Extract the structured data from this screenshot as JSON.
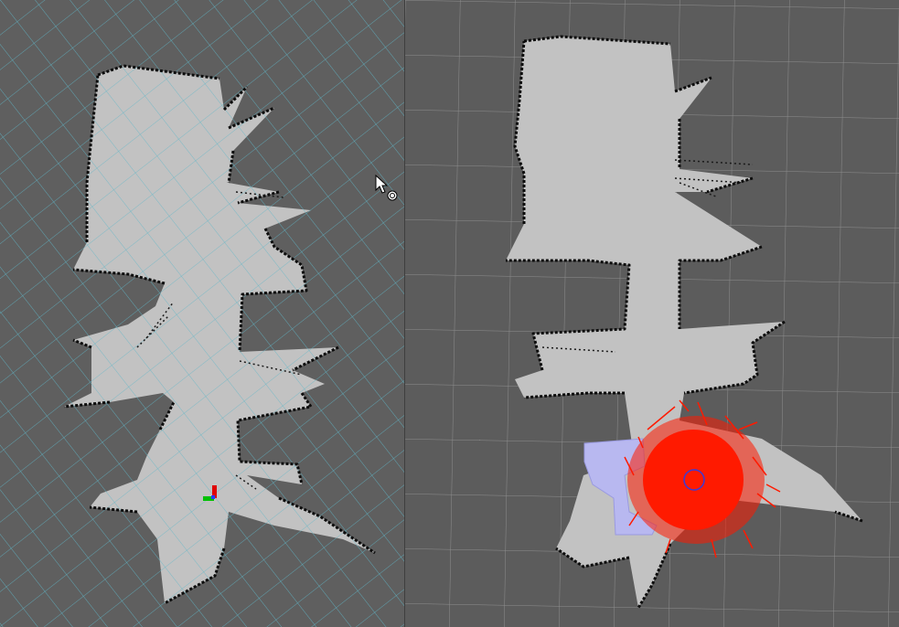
{
  "viewports": [
    {
      "name": "slam-map-view",
      "grid_color": "#5fb6c8",
      "background_color": "#5f5f5f",
      "free_space_color": "#c2c2c2",
      "wall_color": "#0d0d0d",
      "axes": {
        "x_color": "#00c000",
        "y_color": "#e00000"
      }
    },
    {
      "name": "localization-view",
      "grid_color": "#8e8e8e",
      "background_color": "#5c5c5c",
      "free_space_color": "#c2c2c2",
      "wall_color": "#0d0d0d",
      "particle_color": "#ff1a00",
      "robot_marker_color": "#3b3bd6",
      "footprint_color": "#b8b8f0"
    }
  ],
  "cursor": {
    "icon": "arrow-cursor-icon",
    "badge": "rotate-icon"
  }
}
